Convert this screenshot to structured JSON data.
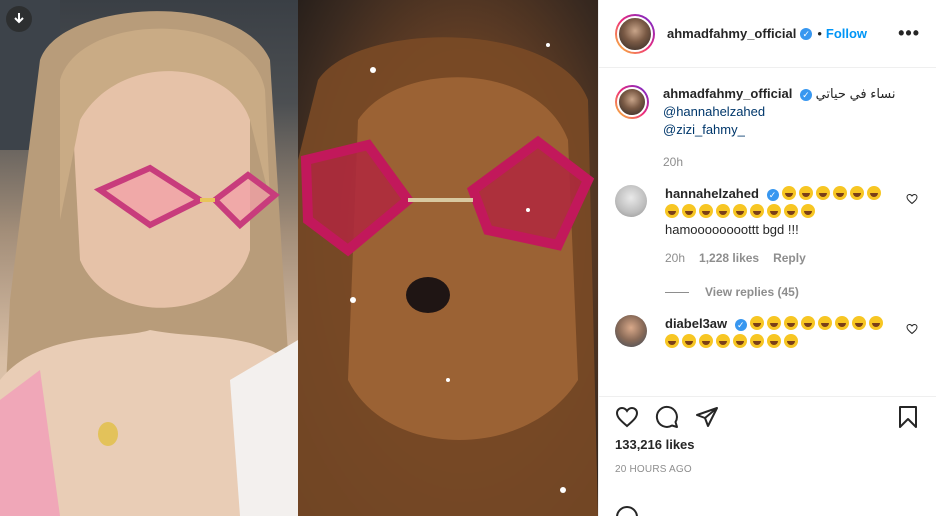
{
  "post": {
    "author": "ahmadfahmy_official",
    "follow_label": "Follow",
    "separator": "•",
    "more_label": "•••",
    "caption": {
      "text": "نساء في حياتي",
      "mention_1": "@hannahelzahed",
      "mention_2": "@zizi_fahmy_",
      "time": "20h"
    },
    "likes": "133,216 likes",
    "timestamp": "20 HOURS AGO"
  },
  "comments": [
    {
      "user": "hannahelzahed",
      "emoji_count": 15,
      "text": "hamoooooooottt bgd !!!",
      "time": "20h",
      "likes": "1,228 likes",
      "reply_label": "Reply",
      "view_replies": "View replies (45)"
    },
    {
      "user": "diabel3aw",
      "emoji_count": 16,
      "text": ""
    }
  ],
  "icons": {
    "download": "download-icon",
    "verified": "verified-badge-icon",
    "heart": "heart-icon",
    "comment": "comment-icon",
    "share": "share-icon",
    "save": "bookmark-icon",
    "more": "more-options-icon"
  },
  "colors": {
    "accent": "#0095f6",
    "verified": "#3897f0",
    "secondary_text": "#8e8e8e",
    "mention": "#00376b",
    "border": "#efefef"
  }
}
